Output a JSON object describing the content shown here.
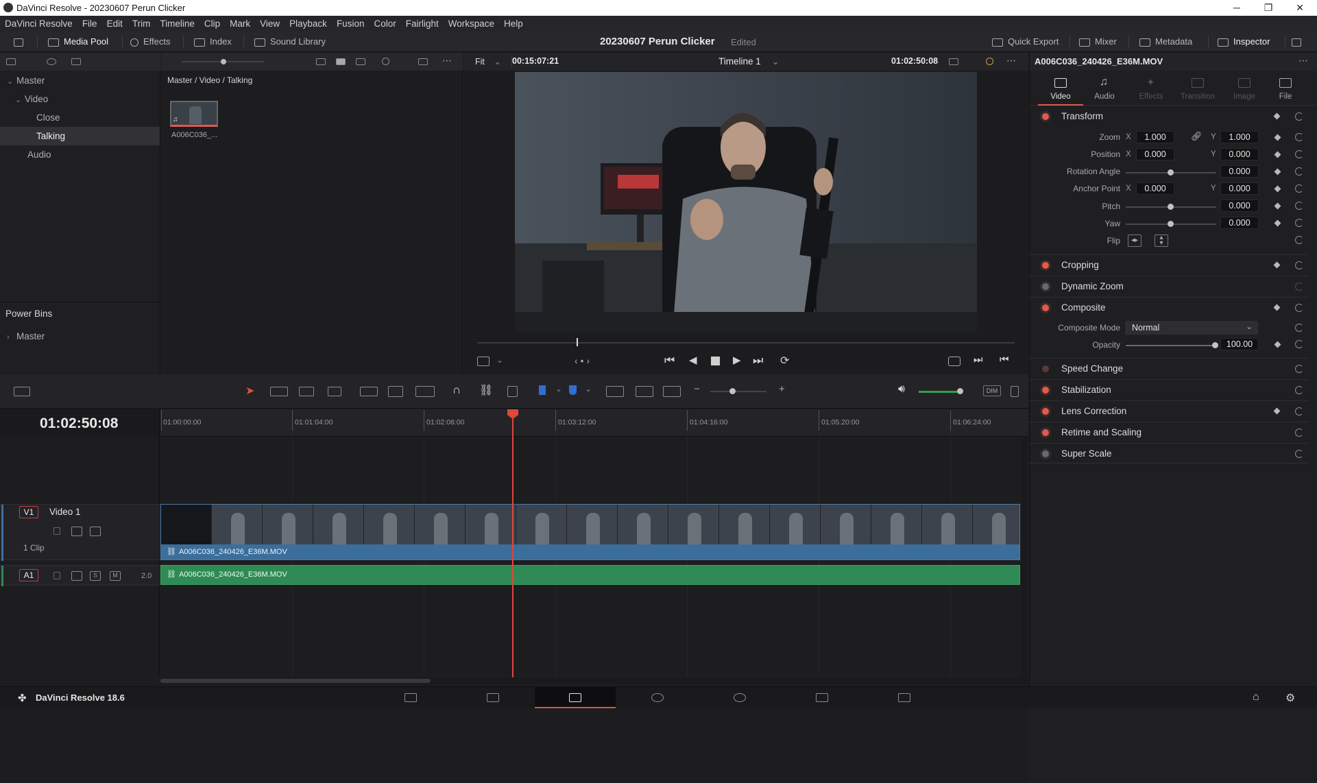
{
  "window": {
    "title": "DaVinci Resolve - 20230607 Perun Clicker",
    "minimize": "─",
    "maximize": "❐",
    "close": "✕"
  },
  "menu": [
    "DaVinci Resolve",
    "File",
    "Edit",
    "Trim",
    "Timeline",
    "Clip",
    "Mark",
    "View",
    "Playback",
    "Fusion",
    "Color",
    "Fairlight",
    "Workspace",
    "Help"
  ],
  "toolbar": {
    "media_pool": "Media Pool",
    "effects": "Effects",
    "index": "Index",
    "sound_library": "Sound Library",
    "project_title": "20230607 Perun Clicker",
    "edited": "Edited",
    "quick_export": "Quick Export",
    "mixer": "Mixer",
    "metadata": "Metadata",
    "inspector": "Inspector"
  },
  "media_pool": {
    "bins": {
      "master": "Master",
      "video": "Video",
      "close": "Close",
      "talking": "Talking",
      "audio": "Audio"
    },
    "power_bins_title": "Power Bins",
    "power_bins_master": "Master",
    "breadcrumb": "Master / Video / Talking",
    "clip_name": "A006C036_..."
  },
  "viewer": {
    "fit": "Fit",
    "source_timecode": "00:15:07:21",
    "timeline_name": "Timeline 1",
    "record_timecode": "01:02:50:08"
  },
  "inspector": {
    "clip_title": "A006C036_240426_E36M.MOV",
    "tabs": [
      "Video",
      "Audio",
      "Effects",
      "Transition",
      "Image",
      "File"
    ],
    "transform": {
      "title": "Transform",
      "zoom_label": "Zoom",
      "zoom_x": "1.000",
      "zoom_y": "1.000",
      "position_label": "Position",
      "position_x": "0.000",
      "position_y": "0.000",
      "rotation_label": "Rotation Angle",
      "rotation": "0.000",
      "anchor_label": "Anchor Point",
      "anchor_x": "0.000",
      "anchor_y": "0.000",
      "pitch_label": "Pitch",
      "pitch": "0.000",
      "yaw_label": "Yaw",
      "yaw": "0.000",
      "flip_label": "Flip",
      "x": "X",
      "y": "Y"
    },
    "cropping": "Cropping",
    "dynamic_zoom": "Dynamic Zoom",
    "composite": {
      "title": "Composite",
      "mode_label": "Composite Mode",
      "mode_value": "Normal",
      "opacity_label": "Opacity",
      "opacity_value": "100.00"
    },
    "speed_change": "Speed Change",
    "stabilization": "Stabilization",
    "lens_correction": "Lens Correction",
    "retime_scaling": "Retime and Scaling",
    "super_scale": "Super Scale"
  },
  "timeline": {
    "timecode": "01:02:50:08",
    "ruler": [
      "01:00:00:00",
      "01:01:04:00",
      "01:02:08:00",
      "01:03:12:00",
      "01:04:16:00",
      "01:05:20:00",
      "01:06:24:00"
    ],
    "v1_badge": "V1",
    "v1_name": "Video 1",
    "v1_clips": "1 Clip",
    "a1_badge": "A1",
    "a1_channels": "2.0",
    "solo": "S",
    "mute": "M",
    "dim": "DIM",
    "video_clip_name": "A006C036_240426_E36M.MOV",
    "audio_clip_name": "A006C036_240426_E36M.MOV"
  },
  "footer": {
    "app_version": "DaVinci Resolve 18.6"
  },
  "colors": {
    "video_clip": "#3b6e9a",
    "audio_clip": "#2f8a55",
    "playhead": "#e0463a"
  }
}
